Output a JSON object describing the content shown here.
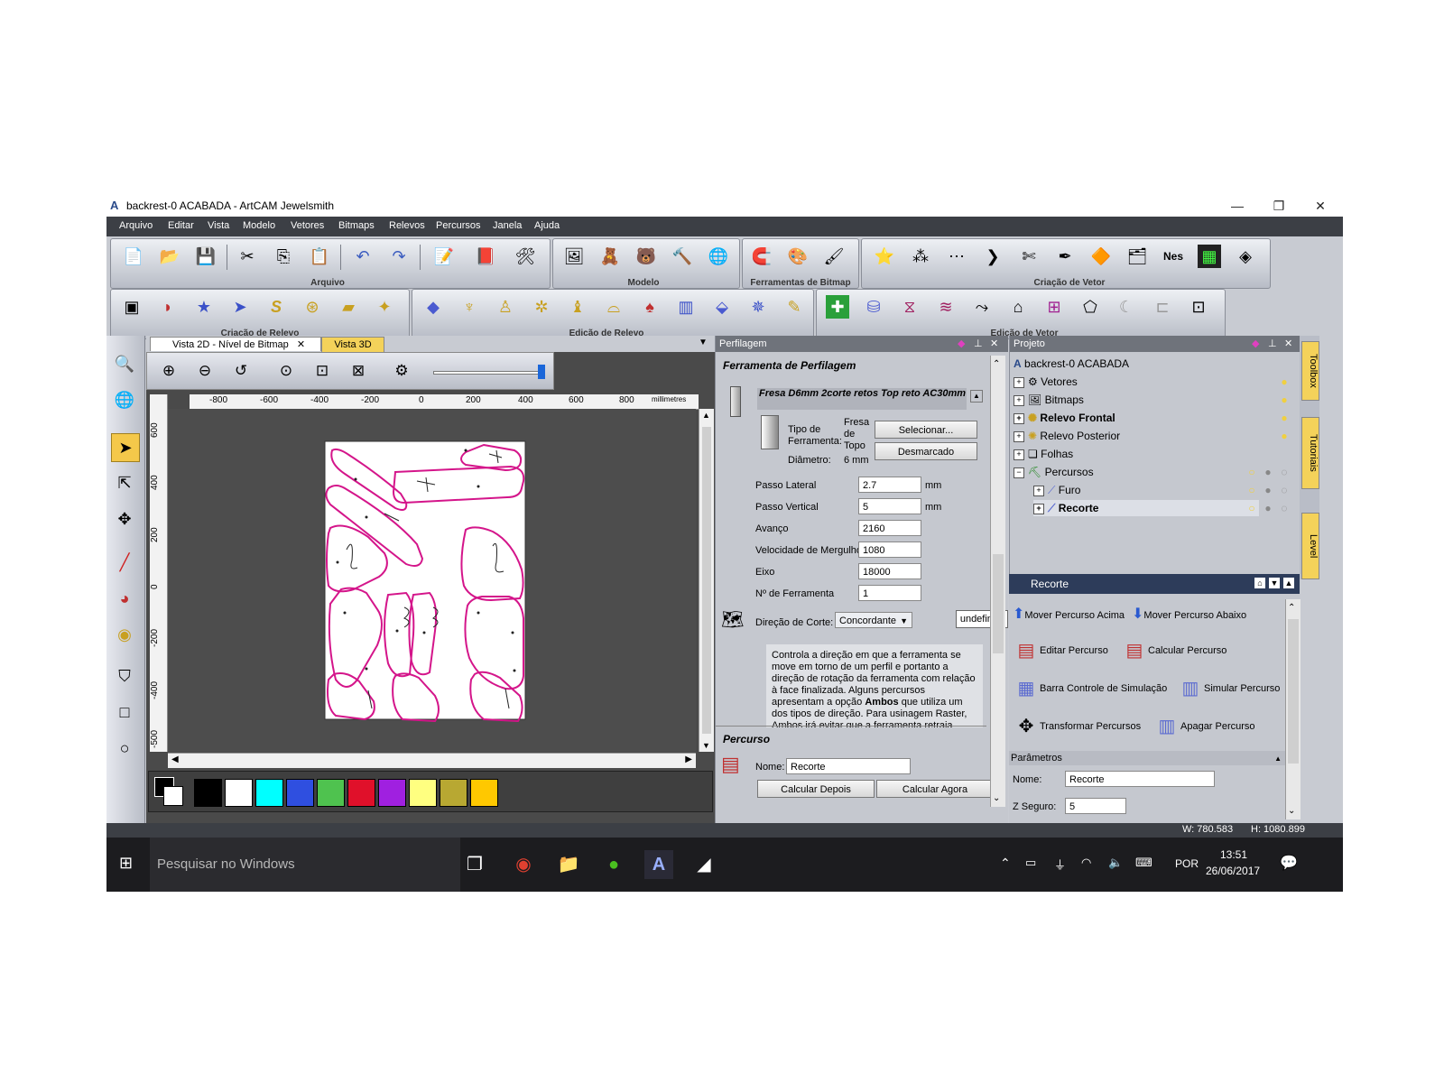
{
  "window": {
    "title": "backrest-0 ACABADA - ArtCAM Jewelsmith",
    "min": "—",
    "max": "❐",
    "close": "✕"
  },
  "menu": [
    "Arquivo",
    "Editar",
    "Vista",
    "Modelo",
    "Vetores",
    "Bitmaps",
    "Relevos",
    "Percursos",
    "Janela",
    "Ajuda"
  ],
  "toolbar_groups": {
    "arquivo": "Arquivo",
    "modelo": "Modelo",
    "ferramentas_bitmap": "Ferramentas de Bitmap",
    "criacao_vetor": "Criação de Vetor",
    "criacao_relevo": "Criação de Relevo",
    "edicao_relevo": "Edição de Relevo",
    "edicao_vetor": "Edição de Vetor"
  },
  "view": {
    "tab_2d": "Vista 2D - Nível de Bitmap",
    "tab_3d": "Vista 3D",
    "ruler_units": "millimetres",
    "ruler_h": [
      "-800",
      "-600",
      "-400",
      "-200",
      "0",
      "200",
      "400",
      "600",
      "800"
    ],
    "ruler_v": [
      "600",
      "400",
      "200",
      "0",
      "-200",
      "-400",
      "-500"
    ]
  },
  "palette": [
    "#000000",
    "#ffffff",
    "#00ffff",
    "#2f4fe0",
    "#4fc24f",
    "#e0102a",
    "#a020e0",
    "#ffff80",
    "#b8a832",
    "#ffc800"
  ],
  "perfilagem": {
    "header": "Perfilagem",
    "section_tool": "Ferramenta de Perfilagem",
    "tool_name": "Fresa D6mm 2corte retos Top reto AC30mm",
    "tipo_label": "Tipo de Ferramenta:",
    "tipo_value": "Fresa de Topo",
    "diametro_label": "Diâmetro:",
    "diametro_value": "6 mm",
    "btn_selecionar": "Selecionar...",
    "btn_desmarcado": "Desmarcado",
    "passo_lateral_label": "Passo Lateral",
    "passo_lateral": "2.7",
    "passo_lateral_unit": "mm",
    "passo_vertical_label": "Passo Vertical",
    "passo_vertical": "5",
    "passo_vertical_unit": "mm",
    "avanco_label": "Avanço",
    "avanco": "2160",
    "mergulho_label": "Velocidade de Mergulho",
    "mergulho": "1080",
    "eixo_label": "Eixo",
    "eixo": "18000",
    "nferr_label": "Nº de Ferramenta",
    "nferr": "1",
    "direcao_label": "Direção de Corte:",
    "direcao_value": "Concordante",
    "tooltip": "undefined",
    "desc_part1": "Controla a direção em que a ferramenta se move em torno de um perfil e portanto a direção de rotação da ferramenta com relação à face finalizada. Alguns percursos apresentam a opção ",
    "desc_bold": "Ambos",
    "desc_part2": " que utiliza um dos tipos de direção. Para usinagem Raster, Ambos irá evitar que a ferramenta retraia",
    "section_percurso": "Percurso",
    "nome_label": "Nome:",
    "nome_value": "Recorte",
    "btn_depois": "Calcular Depois",
    "btn_agora": "Calcular Agora"
  },
  "projeto": {
    "header": "Projeto",
    "root": "backrest-0 ACABADA",
    "items": [
      "Vetores",
      "Bitmaps",
      "Relevo Frontal",
      "Relevo Posterior",
      "Folhas",
      "Percursos",
      "Furo",
      "Recorte"
    ]
  },
  "recorte": {
    "header": "Recorte",
    "mover_acima": "Mover Percurso Acima",
    "mover_abaixo": "Mover Percurso Abaixo",
    "editar": "Editar Percurso",
    "calcular": "Calcular Percurso",
    "barra": "Barra Controle de Simulação",
    "simular": "Simular Percurso",
    "transformar": "Transformar Percursos",
    "apagar": "Apagar Percurso",
    "parametros": "Parâmetros",
    "nome_label": "Nome:",
    "nome_value": "Recorte",
    "zseguro_label": "Z Seguro:",
    "zseguro_value": "5"
  },
  "side_tabs": [
    "Toolbox",
    "Tutoriais",
    "Level"
  ],
  "status": {
    "w": "W: 780.583",
    "h": "H: 1080.899"
  },
  "taskbar": {
    "search": "Pesquisar no Windows",
    "lang": "POR",
    "time": "13:51",
    "date": "26/06/2017"
  }
}
